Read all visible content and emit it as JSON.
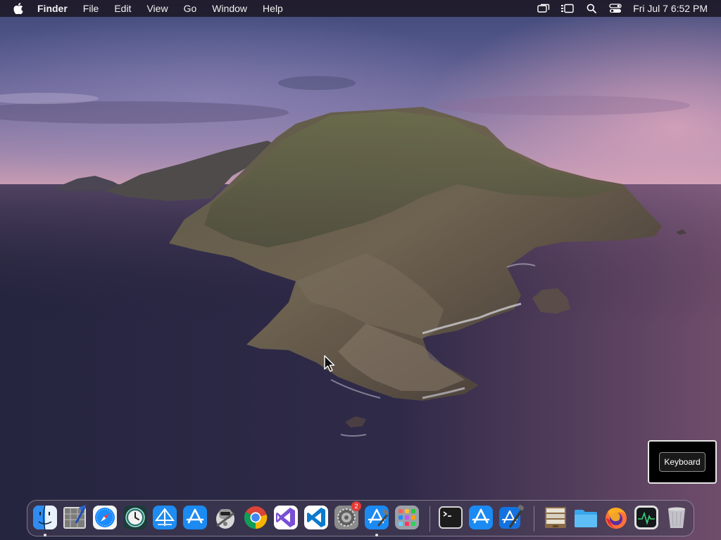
{
  "menubar": {
    "apple_icon": "apple-icon",
    "app_name": "Finder",
    "menus": [
      "File",
      "Edit",
      "View",
      "Go",
      "Window",
      "Help"
    ],
    "status_icons": [
      "screen-mirroring-icon",
      "stage-manager-icon",
      "spotlight-search-icon",
      "control-center-icon"
    ],
    "clock": "Fri Jul 7  6:52 PM"
  },
  "popup": {
    "button_label": "Keyboard"
  },
  "dock": {
    "apps": [
      {
        "name": "Finder",
        "icon": "finder-icon",
        "running": true
      },
      {
        "name": "Script Editor",
        "icon": "script-editor-icon",
        "running": false
      },
      {
        "name": "Safari",
        "icon": "safari-icon",
        "running": false
      },
      {
        "name": "Time Machine",
        "icon": "time-machine-icon",
        "running": false
      },
      {
        "name": "Instruments",
        "icon": "instruments-icon",
        "running": false
      },
      {
        "name": "App Store",
        "icon": "app-store-icon",
        "running": false
      },
      {
        "name": "Automator",
        "icon": "automator-icon",
        "running": false
      },
      {
        "name": "Google Chrome",
        "icon": "chrome-icon",
        "running": false
      },
      {
        "name": "Visual Studio",
        "icon": "visual-studio-icon",
        "running": false
      },
      {
        "name": "Visual Studio Code",
        "icon": "vscode-icon",
        "running": false
      },
      {
        "name": "System Settings",
        "icon": "system-settings-icon",
        "running": false,
        "badge": "2"
      },
      {
        "name": "Xcode Installer",
        "icon": "xcode-installer-icon",
        "running": true
      },
      {
        "name": "Launchpad",
        "icon": "launchpad-icon",
        "running": false
      },
      {
        "name": "Terminal",
        "icon": "terminal-icon",
        "running": false
      },
      {
        "name": "App Store",
        "icon": "app-store-icon",
        "running": false
      },
      {
        "name": "Xcode",
        "icon": "xcode-icon",
        "running": false
      },
      {
        "name": "Archive Utility",
        "icon": "archive-icon",
        "running": false
      },
      {
        "name": "Folder",
        "icon": "folder-icon",
        "running": false
      },
      {
        "name": "Firefox",
        "icon": "firefox-icon",
        "running": false
      },
      {
        "name": "Activity Monitor",
        "icon": "activity-monitor-icon",
        "running": false
      },
      {
        "name": "Trash",
        "icon": "trash-icon",
        "running": false
      }
    ]
  },
  "colors": {
    "menubar_bg": "#1e1a28",
    "badge": "#e53b35",
    "accent_blue": "#1a8cff"
  }
}
